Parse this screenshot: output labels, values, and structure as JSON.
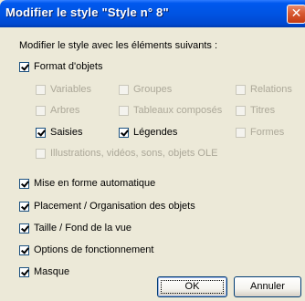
{
  "dialog": {
    "title": "Modifier le style \"Style n° 8\"",
    "close_symbol": "✕",
    "intro": "Modifier le style avec les éléments suivants :"
  },
  "options": {
    "format_objets": {
      "label": "Format d'objets",
      "checked": true,
      "enabled": true
    },
    "variables": {
      "label": "Variables",
      "checked": false,
      "enabled": false
    },
    "groupes": {
      "label": "Groupes",
      "checked": false,
      "enabled": false
    },
    "relations": {
      "label": "Relations",
      "checked": false,
      "enabled": false
    },
    "arbres": {
      "label": "Arbres",
      "checked": false,
      "enabled": false
    },
    "tableaux": {
      "label": "Tableaux composés",
      "checked": false,
      "enabled": false
    },
    "titres": {
      "label": "Titres",
      "checked": false,
      "enabled": false
    },
    "saisies": {
      "label": "Saisies",
      "checked": true,
      "enabled": true
    },
    "legendes": {
      "label": "Légendes",
      "checked": true,
      "enabled": true
    },
    "formes": {
      "label": "Formes",
      "checked": false,
      "enabled": false
    },
    "illustrations": {
      "label": "Illustrations, vidéos, sons, objets OLE",
      "checked": false,
      "enabled": false
    },
    "mise_en_forme": {
      "label": "Mise en forme automatique",
      "checked": true,
      "enabled": true
    },
    "placement": {
      "label": "Placement / Organisation des objets",
      "checked": true,
      "enabled": true
    },
    "taille_fond": {
      "label": "Taille / Fond de la vue",
      "checked": true,
      "enabled": true
    },
    "options_fonct": {
      "label": "Options de fonctionnement",
      "checked": true,
      "enabled": true
    },
    "masque": {
      "label": "Masque",
      "checked": true,
      "enabled": true
    }
  },
  "buttons": {
    "ok": "OK",
    "cancel": "Annuler"
  }
}
